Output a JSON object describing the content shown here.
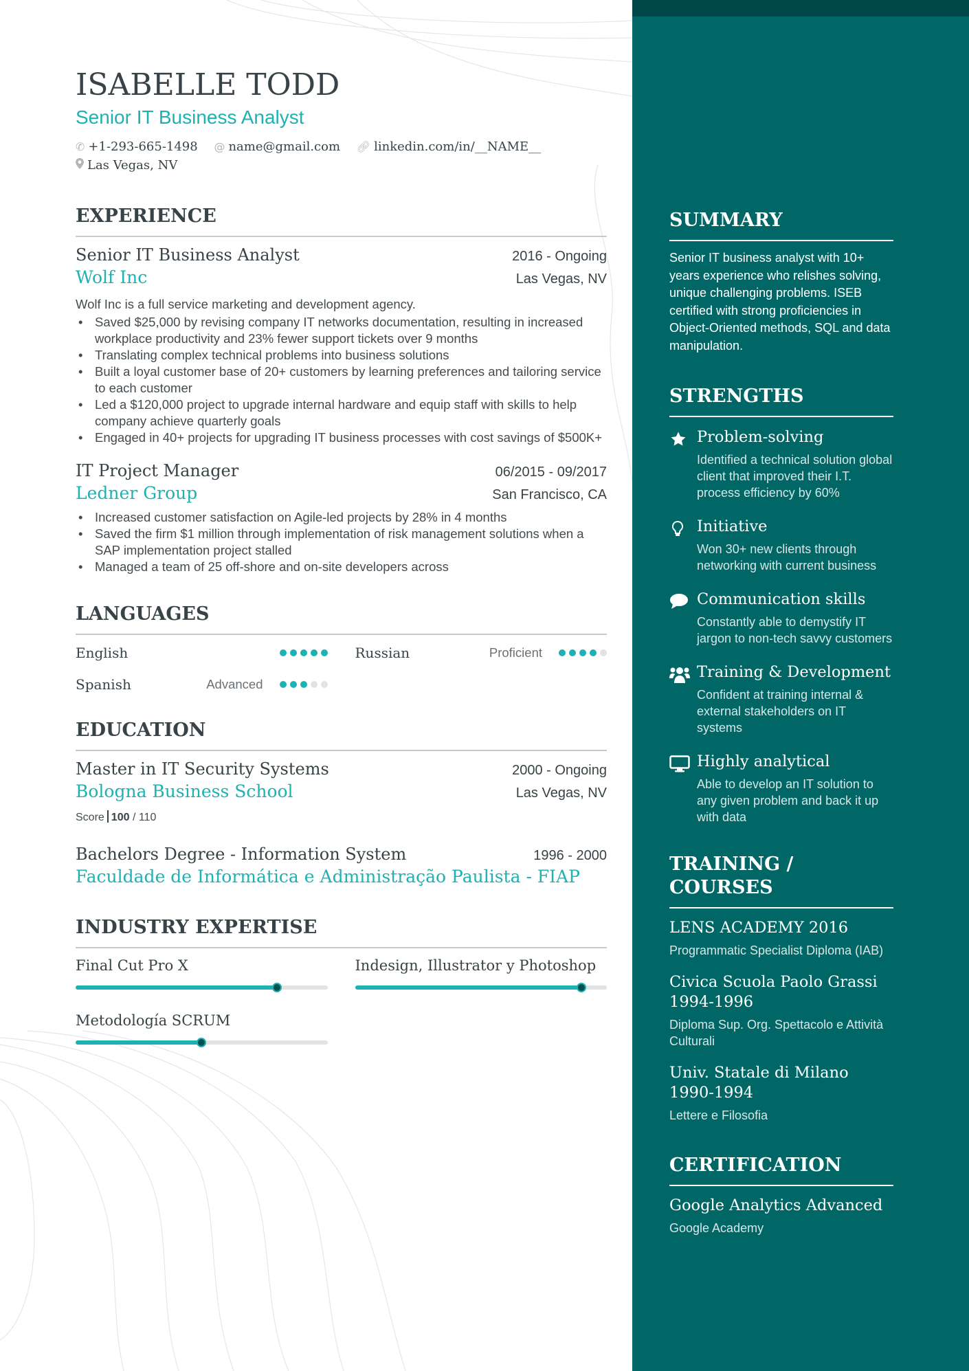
{
  "header": {
    "name": "ISABELLE TODD",
    "title": "Senior IT Business Analyst",
    "contacts": [
      {
        "icon": "phone-icon",
        "text": "+1-293-665-1498"
      },
      {
        "icon": "at-icon",
        "text": "name@gmail.com"
      },
      {
        "icon": "link-icon",
        "text": "linkedin.com/in/__NAME__"
      },
      {
        "icon": "location-pin-icon",
        "text": "Las Vegas, NV"
      }
    ]
  },
  "experience": {
    "heading": "EXPERIENCE",
    "jobs": [
      {
        "title": "Senior IT Business Analyst",
        "date": "2016 - Ongoing",
        "company": "Wolf Inc",
        "location": "Las Vegas, NV",
        "description": "Wolf Inc is a full service marketing and development agency.",
        "bullets": [
          "Saved $25,000 by revising company IT networks documentation, resulting in increased workplace productivity and 23% fewer support tickets over 9 months",
          "Translating complex technical problems into business solutions",
          "Built a loyal customer base of 20+ customers by learning preferences and tailoring service to each customer",
          "Led a $120,000 project to upgrade internal hardware and equip staff with skills to help company achieve quarterly goals",
          "Engaged in 40+ projects for upgrading IT business processes with cost savings of $500K+"
        ]
      },
      {
        "title": "IT Project Manager",
        "date": "06/2015 - 09/2017",
        "company": "Ledner Group",
        "location": "San Francisco, CA",
        "description": "",
        "bullets": [
          "Increased customer satisfaction on Agile-led projects by 28% in 4 months",
          "Saved the firm $1 million through implementation of risk management solutions when a SAP implementation project stalled",
          "Managed a team of 25 off-shore and on-site developers across"
        ]
      }
    ]
  },
  "languages": {
    "heading": "LANGUAGES",
    "items": [
      {
        "name": "English",
        "level": "",
        "rating": 5,
        "max": 5
      },
      {
        "name": "Russian",
        "level": "Proficient",
        "rating": 4,
        "max": 5
      },
      {
        "name": "Spanish",
        "level": "Advanced",
        "rating": 3,
        "max": 5
      }
    ]
  },
  "education": {
    "heading": "EDUCATION",
    "items": [
      {
        "degree": "Master in IT Security Systems",
        "date": "2000 - Ongoing",
        "school": "Bologna Business School",
        "location": "Las Vegas, NV",
        "score_label": "Score",
        "score": "100",
        "score_max": "/ 110"
      },
      {
        "degree": "Bachelors Degree - Information System",
        "date": "1996 - 2000",
        "school": "Faculdade de Informática e Administração Paulista - FIAP",
        "location": ""
      }
    ]
  },
  "expertise": {
    "heading": "INDUSTRY EXPERTISE",
    "items": [
      {
        "name": "Final Cut Pro X",
        "level_percent": 80
      },
      {
        "name": "Indesign, Illustrator y Photoshop",
        "level_percent": 90
      },
      {
        "name": "Metodología SCRUM",
        "level_percent": 50
      }
    ]
  },
  "summary": {
    "heading": "SUMMARY",
    "text": "Senior IT business analyst with 10+ years experience who relishes solving, unique challenging problems. ISEB certified with strong proficiencies in Object-Oriented methods, SQL and data manipulation."
  },
  "strengths": {
    "heading": "STRENGTHS",
    "items": [
      {
        "icon": "star-icon",
        "title": "Problem-solving",
        "desc": "Identified a technical solution global client that improved their I.T. process efficiency by 60%"
      },
      {
        "icon": "lightbulb-icon",
        "title": "Initiative",
        "desc": "Won 30+ new clients through networking with current business"
      },
      {
        "icon": "speech-bubble-icon",
        "title": "Communication skills",
        "desc": "Constantly able to demystify IT jargon to non-tech savvy customers"
      },
      {
        "icon": "users-icon",
        "title": "Training & Development",
        "desc": "Confident at training internal & external stakeholders on IT systems"
      },
      {
        "icon": "monitor-icon",
        "title": "Highly analytical",
        "desc": "Able to develop an IT solution to any given problem and back it up with data"
      }
    ]
  },
  "training": {
    "heading": "TRAINING / COURSES",
    "items": [
      {
        "title": "LENS ACADEMY 2016",
        "desc": "Programmatic Specialist Diploma (IAB)"
      },
      {
        "title": "Civica Scuola Paolo Grassi 1994-1996",
        "desc": "Diploma Sup. Org. Spettacolo e Attività Culturali"
      },
      {
        "title": "Univ. Statale di Milano 1990-1994",
        "desc": "Lettere e Filosofia"
      }
    ]
  },
  "certification": {
    "heading": "CERTIFICATION",
    "items": [
      {
        "title": "Google Analytics Advanced",
        "desc": "Google Academy"
      }
    ]
  },
  "colors": {
    "accent": "#1eb1b3",
    "sidebar": "#006766",
    "sidebar_top": "#00474a",
    "text": "#384347"
  }
}
